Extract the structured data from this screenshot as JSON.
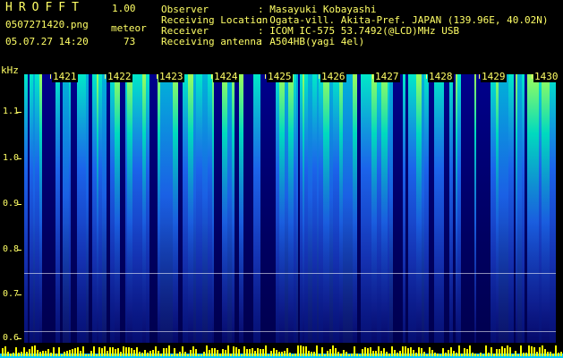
{
  "header": {
    "app_title": "HROFFT",
    "version": "1.00",
    "filename": "0507271420.png",
    "meteor_label": "meteor",
    "datetime": "05.07.27 14:20",
    "meteor_count": "73"
  },
  "info": [
    {
      "label": "Observer",
      "value": ": Masayuki Kobayashi"
    },
    {
      "label": "Receiving Location",
      "value": ": Ogata-vill. Akita-Pref. JAPAN (139.96E, 40.02N)"
    },
    {
      "label": "Receiver",
      "value": ": ICOM IC-575 53.7492(@LCD)MHz USB"
    },
    {
      "label": "Receiving antenna",
      "value": ": A504HB(yagi 4el)"
    }
  ],
  "y_axis": {
    "unit": "kHz",
    "ticks": [
      "1.1",
      "1.0",
      "0.9",
      "0.8",
      "0.7",
      "0.6"
    ]
  },
  "x_axis": {
    "ticks": [
      "1421",
      "1422",
      "1423",
      "1424",
      "1425",
      "1426",
      "1427",
      "1428",
      "1429",
      "1430"
    ]
  },
  "colors": {
    "text": "#ffff66",
    "background": "#000000",
    "spectrum_low": "#00008c",
    "spectrum_mid": "#1e6eff",
    "spectrum_high": "#00e8c8",
    "spectrum_peak": "#9cff5a",
    "activity_bar": "#ffff00",
    "activity_base": "#00c8ff"
  }
}
